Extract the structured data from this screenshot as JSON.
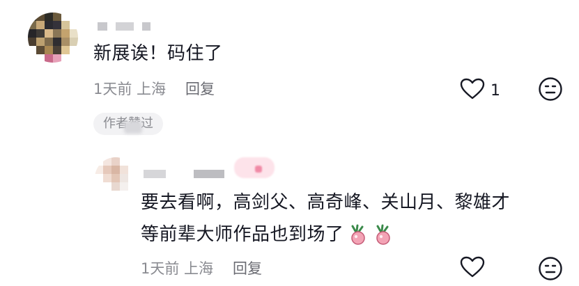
{
  "comment": {
    "text": "新展诶！码住了",
    "time_location": "1天前 上海",
    "reply_label": "回复",
    "like_count": "1",
    "badge": "作者赞过"
  },
  "reply": {
    "line1": "要去看啊，高剑父、高奇峰、关山月、黎雄才",
    "line2": "等前辈大师作品也到场了",
    "time_location": "1天前 上海",
    "reply_label": "回复",
    "emoji": "radish-emoji"
  },
  "icons": {
    "like": "heart-outline-icon",
    "dislike": "neutral-face-icon"
  },
  "colors": {
    "text": "#161823",
    "meta": "#8a8b91",
    "badge_bg": "#f2f2f4"
  }
}
